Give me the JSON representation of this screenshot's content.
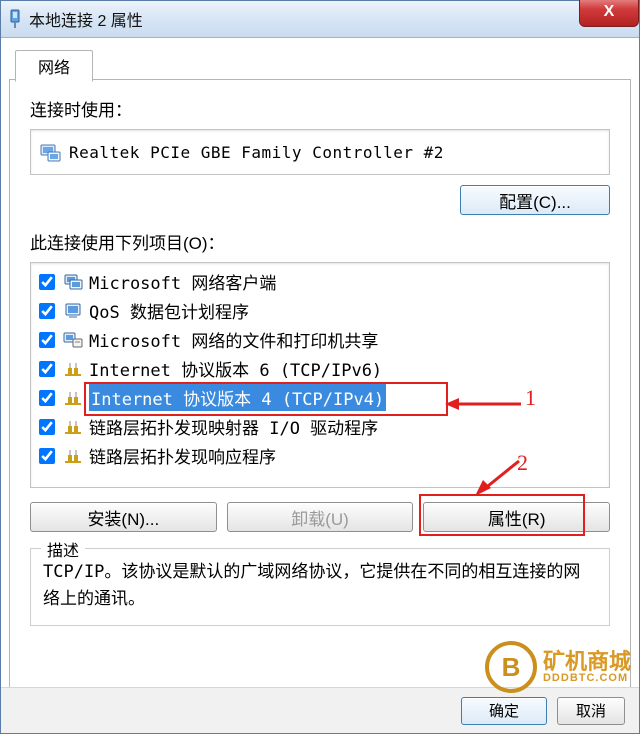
{
  "window": {
    "title": "本地连接 2 属性",
    "close_glyph": "X"
  },
  "tabs": {
    "network": "网络"
  },
  "section": {
    "connect_using": "连接时使用：",
    "adapter": "Realtek PCIe GBE Family Controller #2",
    "configure": "配置(C)...",
    "items_label": "此连接使用下列项目(O)：",
    "install": "安装(N)...",
    "uninstall": "卸载(U)",
    "properties": "属性(R)"
  },
  "items": [
    {
      "checked": true,
      "icon": "client",
      "label": "Microsoft 网络客户端"
    },
    {
      "checked": true,
      "icon": "qos",
      "label": "QoS 数据包计划程序"
    },
    {
      "checked": true,
      "icon": "share",
      "label": "Microsoft 网络的文件和打印机共享"
    },
    {
      "checked": true,
      "icon": "proto",
      "label": "Internet 协议版本 6 (TCP/IPv6)"
    },
    {
      "checked": true,
      "icon": "proto",
      "label": "Internet 协议版本 4 (TCP/IPv4)",
      "selected": true
    },
    {
      "checked": true,
      "icon": "proto",
      "label": "链路层拓扑发现映射器 I/O 驱动程序"
    },
    {
      "checked": true,
      "icon": "proto",
      "label": "链路层拓扑发现响应程序"
    }
  ],
  "description": {
    "legend": "描述",
    "text": "TCP/IP。该协议是默认的广域网络协议，它提供在不同的相互连接的网络上的通讯。"
  },
  "bottom": {
    "ok": "确定",
    "cancel": "取消"
  },
  "annotations": {
    "one": "1",
    "two": "2"
  },
  "watermark": {
    "logo": "B",
    "main": "矿机商城",
    "sub": "DDDBTC.COM"
  }
}
